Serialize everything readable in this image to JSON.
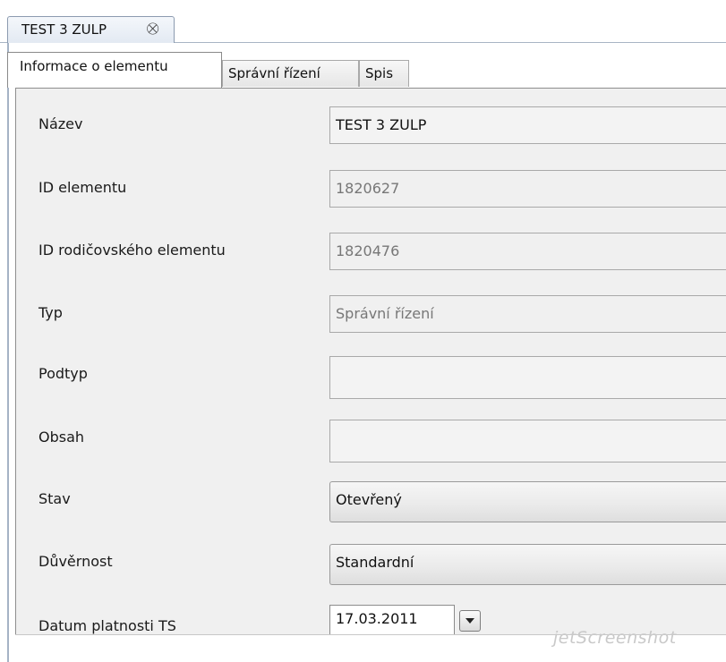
{
  "editor_tab": {
    "title": "TEST 3 ZULP",
    "close_glyph": "⛒"
  },
  "subtabs": [
    "Informace o elementu",
    "Správní řízení",
    "Spis"
  ],
  "form": {
    "nazev": {
      "label": "Název",
      "value": "TEST 3 ZULP"
    },
    "id_elementu": {
      "label": "ID elementu",
      "value": "1820627"
    },
    "id_rodic": {
      "label": "ID rodičovského elementu",
      "value": "1820476"
    },
    "typ": {
      "label": "Typ",
      "value": "Správní řízení"
    },
    "podtyp": {
      "label": "Podtyp",
      "value": ""
    },
    "obsah": {
      "label": "Obsah",
      "value": ""
    },
    "stav": {
      "label": "Stav",
      "value": "Otevřený"
    },
    "duvernost": {
      "label": "Důvěrnost",
      "value": "Standardní"
    },
    "datum": {
      "label": "Datum platnosti TS",
      "value": "17.03.2011"
    }
  },
  "watermark": "jetScreenshot",
  "colors": {
    "panel_bg": "#f0f0f0",
    "tab_border": "#8c9bb0",
    "readonly_text": "#777777"
  }
}
